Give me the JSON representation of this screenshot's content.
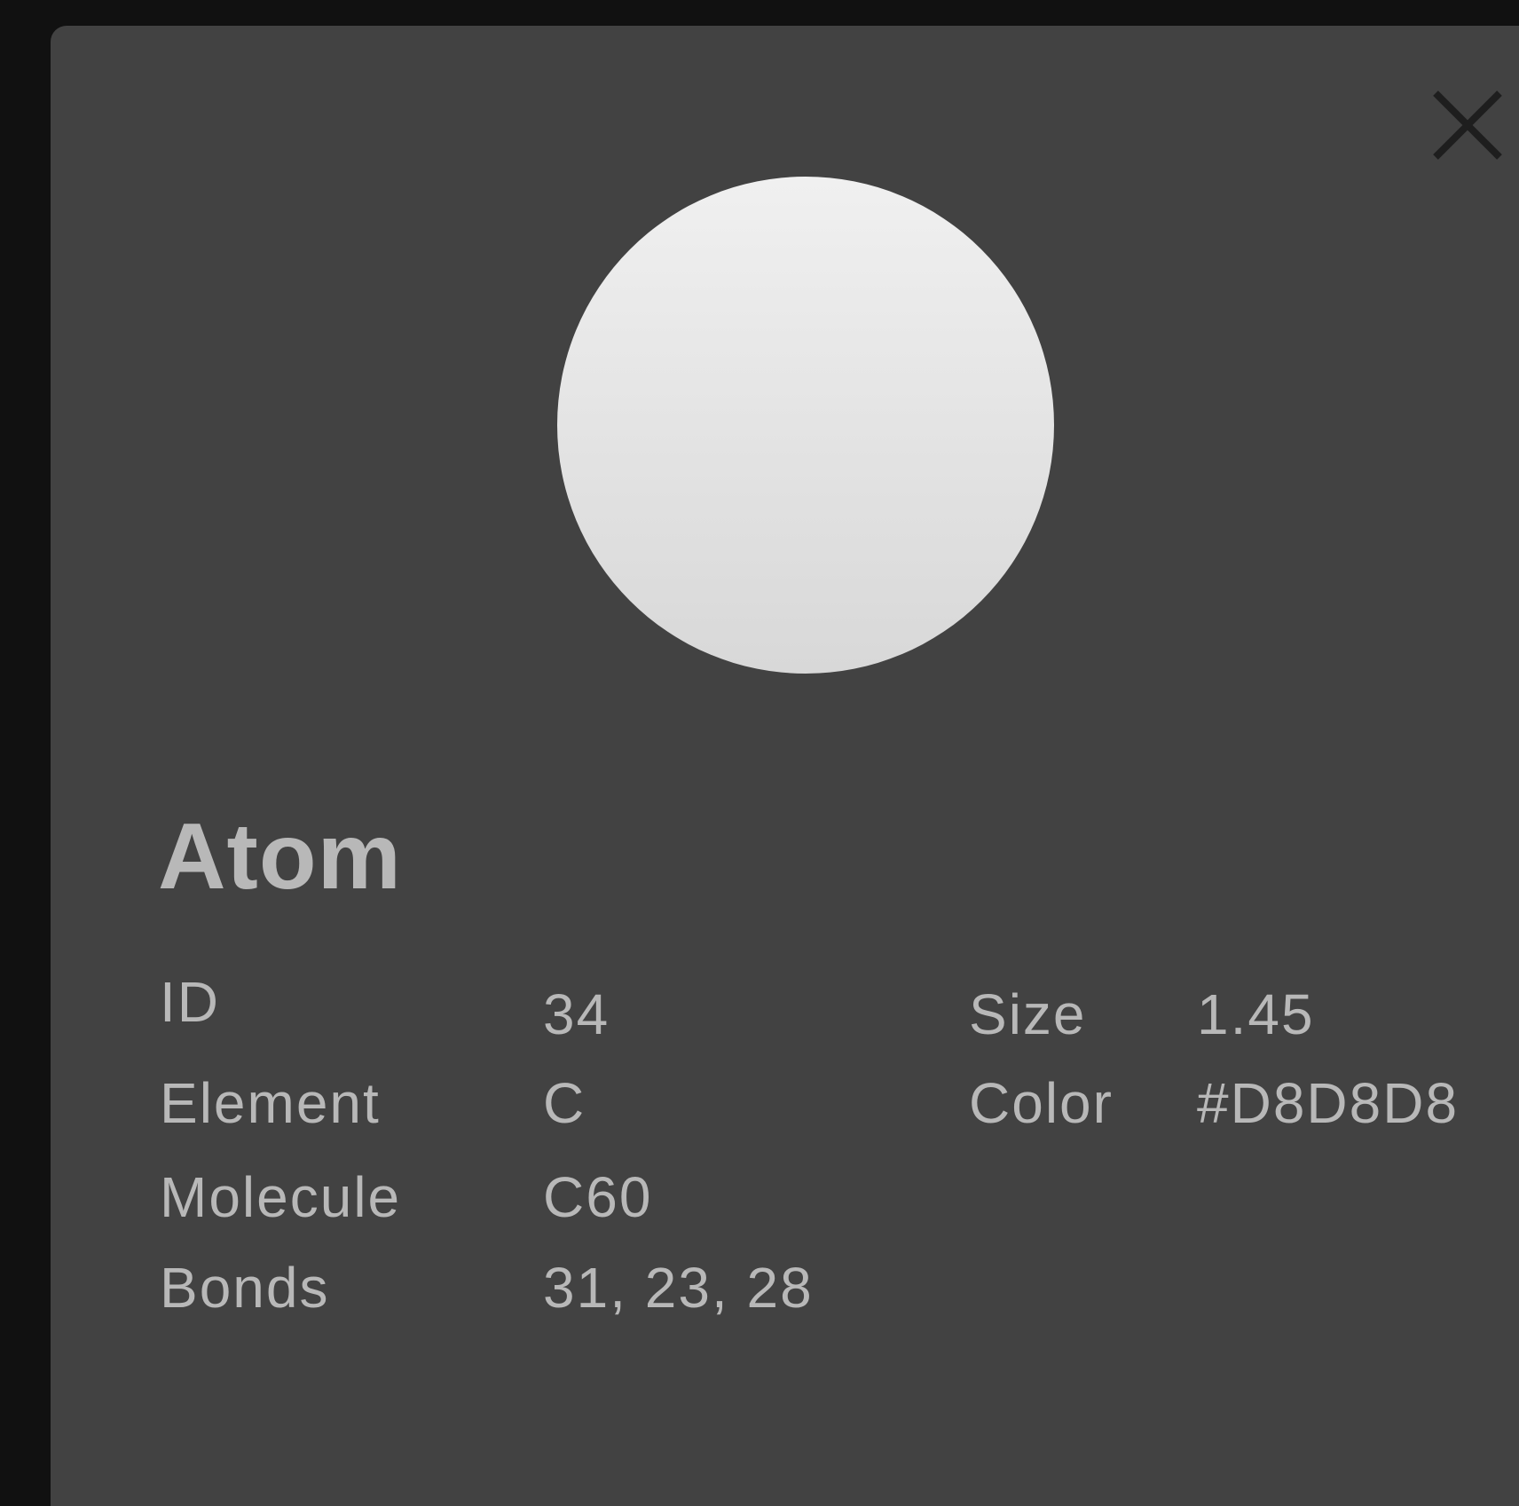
{
  "panel": {
    "close_icon": "close-icon",
    "preview": {
      "color": "#D8D8D8",
      "gradient_top": "#F0F0F0",
      "gradient_bottom": "#D8D8D8"
    },
    "title": "Atom",
    "properties": {
      "id": {
        "label": "ID",
        "value": "34"
      },
      "element": {
        "label": "Element",
        "value": "C"
      },
      "molecule": {
        "label": "Molecule",
        "value": "C60"
      },
      "bonds": {
        "label": "Bonds",
        "value": "31, 23, 28"
      },
      "size": {
        "label": "Size",
        "value": "1.45"
      },
      "color": {
        "label": "Color",
        "value": "#D8D8D8"
      }
    }
  }
}
